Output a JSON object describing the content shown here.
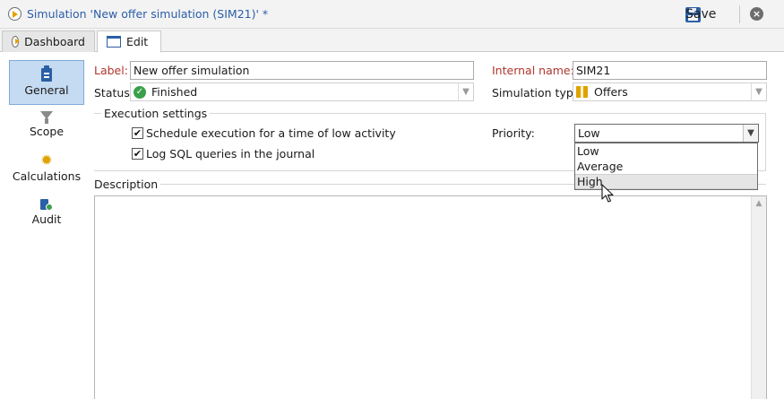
{
  "window": {
    "title": "Simulation 'New offer simulation (SIM21)' *",
    "save_label": "Save",
    "close_glyph": "×"
  },
  "tabs": [
    {
      "label": "Dashboard",
      "icon": "play-icon",
      "active": false
    },
    {
      "label": "Edit",
      "icon": "window-icon",
      "active": true
    }
  ],
  "nav": {
    "items": [
      {
        "label": "General",
        "icon": "clipboard-icon",
        "active": true
      },
      {
        "label": "Scope",
        "icon": "funnel-icon",
        "active": false
      },
      {
        "label": "Calculations",
        "icon": "gear-icon",
        "active": false
      },
      {
        "label": "Audit",
        "icon": "audit-icon",
        "active": false
      }
    ]
  },
  "form": {
    "label_label": "Label:",
    "label_value": "New offer simulation",
    "internal_name_label": "Internal name:",
    "internal_name_value": "SIM21",
    "status_label": "Status:",
    "status_value": "Finished",
    "simulation_type_label": "Simulation type:",
    "simulation_type_value": "Offers"
  },
  "execution": {
    "group_title": "Execution settings",
    "schedule_label": "Schedule execution for a time of low activity",
    "schedule_checked": true,
    "log_sql_label": "Log SQL queries in the journal",
    "log_sql_checked": true,
    "priority_label": "Priority:",
    "priority_value": "Low",
    "priority_options": [
      "Low",
      "Average",
      "High"
    ],
    "priority_hovered": "High",
    "check_glyph": "✔"
  },
  "description": {
    "title": "Description",
    "value": ""
  },
  "colors": {
    "title_blue": "#2a5da8",
    "required_red": "#b0352d",
    "active_nav": "#c5dbf2",
    "status_green": "#3aa04a",
    "accent_gold": "#e0a100"
  }
}
